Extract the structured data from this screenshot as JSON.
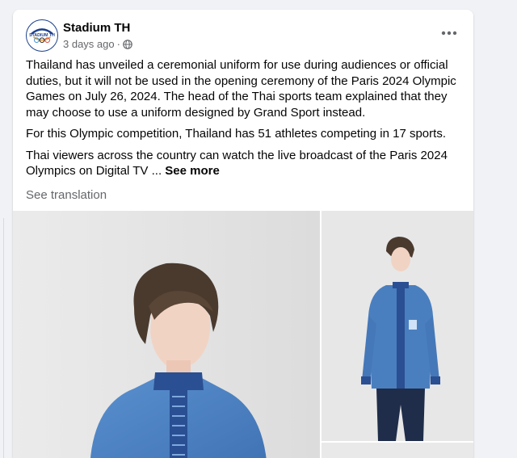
{
  "post": {
    "page_name": "Stadium TH",
    "timestamp": "3 days ago",
    "audience_icon": "globe-icon",
    "more_icon": "more-options-icon",
    "paragraphs": [
      "Thailand has unveiled a ceremonial uniform for use during audiences or official duties, but it will not be used in the opening ceremony of the Paris 2024 Olympic Games on July 26, 2024. The head of the Thai sports team explained that they may choose to use a uniform designed by Grand Sport instead.",
      "For this Olympic competition, Thailand has 51 athletes competing in 17 sports."
    ],
    "truncated_text": "Thai viewers across the country can watch the live broadcast of the Paris 2024 Olympics on Digital TV ... ",
    "see_more_label": "See more",
    "see_translation_label": "See translation",
    "avatar_logo_text": "STADIUM TH"
  },
  "colors": {
    "uniform_blue": "#4a7fbf",
    "collar_pattern": "#2a4f93",
    "background": "#f0f2f5",
    "secondary_text": "#65676b"
  }
}
